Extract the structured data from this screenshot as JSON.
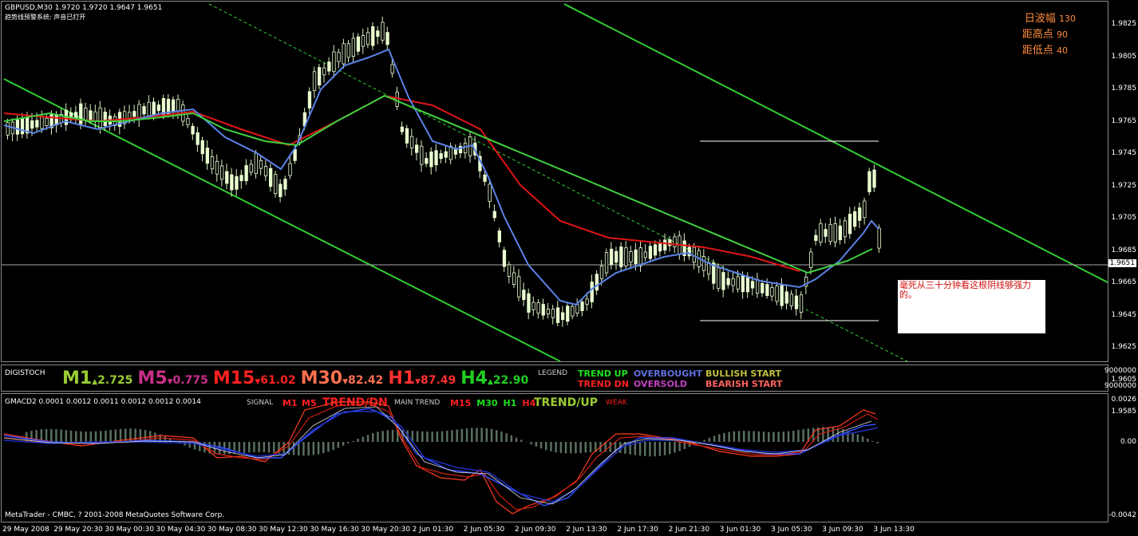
{
  "window": {
    "symbol_line": "GBPUSD,M30  1.9720 1.9720 1.9647 1.9651",
    "indicator_line": "趋势线预警系统: 声音已打开",
    "copyright": "MetaTrader - CMBC, ? 2001-2008 MetaQuotes Software Corp."
  },
  "stats": {
    "daily_range_label": "日波幅",
    "daily_range_value": "130",
    "from_high_label": "距高点",
    "from_high_value": "90",
    "from_low_label": "距低点",
    "from_low_value": "40"
  },
  "note": {
    "text": "毫死从三十分钟看这根阴线够强力的。"
  },
  "price_axis": {
    "ticks": [
      "1.9825",
      "1.9805",
      "1.9785",
      "1.9765",
      "1.9745",
      "1.9725",
      "1.9705",
      "1.9685",
      "1.9665",
      "1.9645",
      "1.9625",
      "1.9605",
      "1.9585"
    ],
    "current": "1.9651"
  },
  "digistoch": {
    "title": "DIGISTOCH",
    "timeframes": [
      {
        "label": "M1",
        "arrow": "▲",
        "value": "2.725",
        "color": "#9acd32",
        "arrow_color": "#9acd32"
      },
      {
        "label": "M5",
        "arrow": "▼",
        "value": "0.775",
        "color": "#c7308a",
        "arrow_color": "#c7308a"
      },
      {
        "label": "M15",
        "arrow": "▼",
        "value": "61.02",
        "color": "#ff2020",
        "arrow_color": "#ff2020"
      },
      {
        "label": "M30",
        "arrow": "▼",
        "value": "82.42",
        "color": "#ff7050",
        "arrow_color": "#ff7050"
      },
      {
        "label": "H1",
        "arrow": "▼",
        "value": "87.49",
        "color": "#ff3030",
        "arrow_color": "#ff3030"
      },
      {
        "label": "H4",
        "arrow": "▲",
        "value": "22.90",
        "color": "#20d020",
        "arrow_color": "#20d020"
      }
    ],
    "legend_label": "LEGEND",
    "legend": {
      "trend_up": "TREND UP",
      "trend_dn": "TREND DN",
      "overbought": "OVERBOUGHT",
      "oversold": "OVERSOLD",
      "bullish_start": "BULLISH START",
      "bearish_start": "BEARISH START"
    },
    "axis_top": "9000000",
    "axis_bottom": "9000000"
  },
  "gmacd": {
    "title": "GMACD2 0.0001 0.0012 0.0011 0.0012 0.0012 0.0014",
    "signal_label": "SIGNAL",
    "signal_tfs": [
      "M1",
      "M5"
    ],
    "signal_trend": "TREND/DN",
    "main_trend_label": "MAIN TREND",
    "main_tfs": [
      {
        "label": "M15",
        "color": "#ff2020"
      },
      {
        "label": "M30",
        "color": "#20e020"
      },
      {
        "label": "H1",
        "color": "#20e020"
      },
      {
        "label": "H4",
        "color": "#ff2020"
      }
    ],
    "main_trend": "TREND/UP",
    "strength": "WEAK",
    "axis": [
      "0.0026",
      "0.00",
      "-0.0042"
    ]
  },
  "time_axis": [
    "29 May 2008",
    "29 May 20:30",
    "30 May 00:30",
    "30 May 04:30",
    "30 May 08:30",
    "30 May 12:30",
    "30 May 16:30",
    "30 May 20:30",
    "2 Jun 01:30",
    "2 Jun 05:30",
    "2 Jun 09:30",
    "2 Jun 13:30",
    "2 Jun 17:30",
    "2 Jun 21:30",
    "3 Jun 01:30",
    "3 Jun 05:30",
    "3 Jun 09:30",
    "3 Jun 13:30"
  ],
  "colors": {
    "candle": "#e8ffd0",
    "channel": "#32cd32",
    "ma_fast": "#5b82e6",
    "ma_slow": "#e01515",
    "ma_green": "#40d040",
    "stats": "#ff8c3c"
  }
}
